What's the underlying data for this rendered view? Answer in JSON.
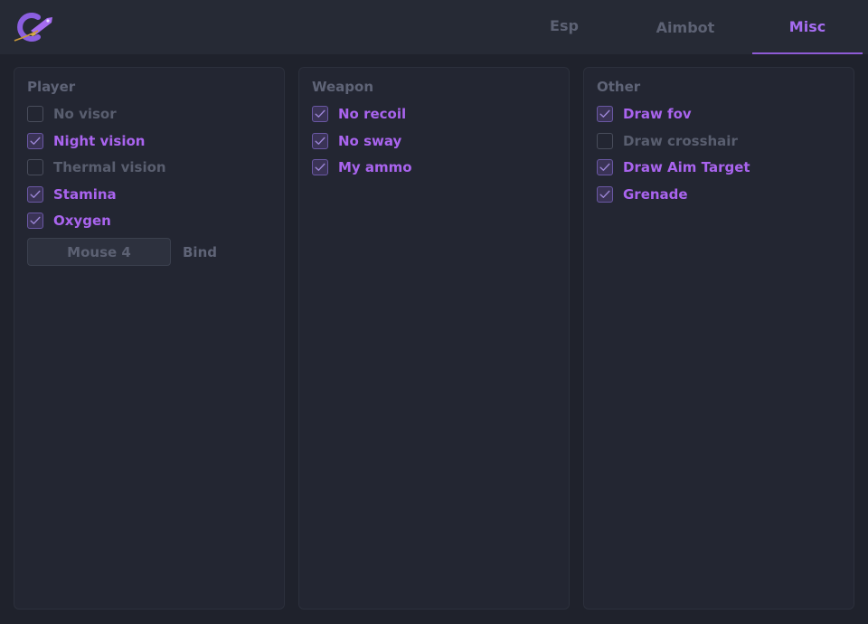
{
  "colors": {
    "accent": "#a964ee",
    "background": "#1f222c",
    "panel": "#232632",
    "muted_text": "#595e6f"
  },
  "header": {
    "logo_icon": "rocket-logo-icon",
    "tabs": [
      {
        "label": "Esp",
        "active": false
      },
      {
        "label": "Aimbot",
        "active": false
      },
      {
        "label": "Misc",
        "active": true
      }
    ]
  },
  "panels": {
    "player": {
      "title": "Player",
      "items": [
        {
          "label": "No visor",
          "checked": false
        },
        {
          "label": "Night vision",
          "checked": true
        },
        {
          "label": "Thermal vision",
          "checked": false
        },
        {
          "label": "Stamina",
          "checked": true
        },
        {
          "label": "Oxygen",
          "checked": true
        }
      ],
      "bind": {
        "key_label": "Mouse 4",
        "label": "Bind"
      }
    },
    "weapon": {
      "title": "Weapon",
      "items": [
        {
          "label": "No recoil",
          "checked": true
        },
        {
          "label": "No sway",
          "checked": true
        },
        {
          "label": "My ammo",
          "checked": true
        }
      ]
    },
    "other": {
      "title": "Other",
      "items": [
        {
          "label": "Draw fov",
          "checked": true
        },
        {
          "label": "Draw crosshair",
          "checked": false
        },
        {
          "label": "Draw Aim Target",
          "checked": true
        },
        {
          "label": "Grenade",
          "checked": true
        }
      ]
    }
  }
}
